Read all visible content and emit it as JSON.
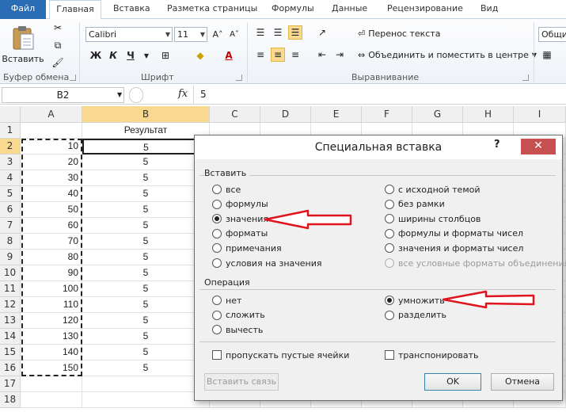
{
  "ribbon": {
    "tabs": [
      "Файл",
      "Главная",
      "Вставка",
      "Разметка страницы",
      "Формулы",
      "Данные",
      "Рецензирование",
      "Вид"
    ],
    "paste_label": "Вставить",
    "font_name": "Calibri",
    "font_size": "11",
    "bold": "Ж",
    "italic": "К",
    "underline": "Ч",
    "wrap_text": "Перенос текста",
    "merge_center": "Объединить и поместить в центре",
    "number_format": "Общий",
    "groups": {
      "clipboard": "Буфер обмена",
      "font": "Шрифт",
      "alignment": "Выравнивание"
    }
  },
  "formula_bar": {
    "name_box": "B2",
    "fx": "fx",
    "value": "5"
  },
  "grid": {
    "columns": [
      "A",
      "B",
      "C",
      "D",
      "E",
      "F",
      "G",
      "H",
      "I"
    ],
    "selected_column": "B",
    "selected_row": "2",
    "rows": [
      "1",
      "2",
      "3",
      "4",
      "5",
      "6",
      "7",
      "8",
      "9",
      "10",
      "11",
      "12",
      "13",
      "14",
      "15",
      "16",
      "17",
      "18"
    ],
    "header_B1": "Результат",
    "col_a": [
      "10",
      "20",
      "30",
      "40",
      "50",
      "60",
      "70",
      "80",
      "90",
      "100",
      "110",
      "120",
      "130",
      "140",
      "150"
    ],
    "col_b": [
      "5",
      "5",
      "5",
      "5",
      "5",
      "5",
      "5",
      "5",
      "5",
      "5",
      "5",
      "5",
      "5",
      "5",
      "5"
    ]
  },
  "dialog": {
    "title": "Специальная вставка",
    "help": "?",
    "close": "✕",
    "paste_group": "Вставить",
    "paste_left": [
      "все",
      "формулы",
      "значения",
      "форматы",
      "примечания",
      "условия на значения"
    ],
    "paste_right": [
      "с исходной темой",
      "без рамки",
      "ширины столбцов",
      "формулы и форматы чисел",
      "значения и форматы чисел",
      "все условные форматы объединения"
    ],
    "paste_selected": "значения",
    "operation_group": "Операция",
    "op_left": [
      "нет",
      "сложить",
      "вычесть"
    ],
    "op_right": [
      "умножить",
      "разделить"
    ],
    "op_selected": "умножить",
    "skip_blanks": "пропускать пустые ячейки",
    "transpose": "транспонировать",
    "paste_link": "Вставить связь",
    "ok": "OK",
    "cancel": "Отмена"
  },
  "colors": {
    "file_tab": "#2a6db5",
    "selected_header": "#f9d98f",
    "close_button": "#c75050",
    "annotation_arrow": "#e0141e"
  }
}
